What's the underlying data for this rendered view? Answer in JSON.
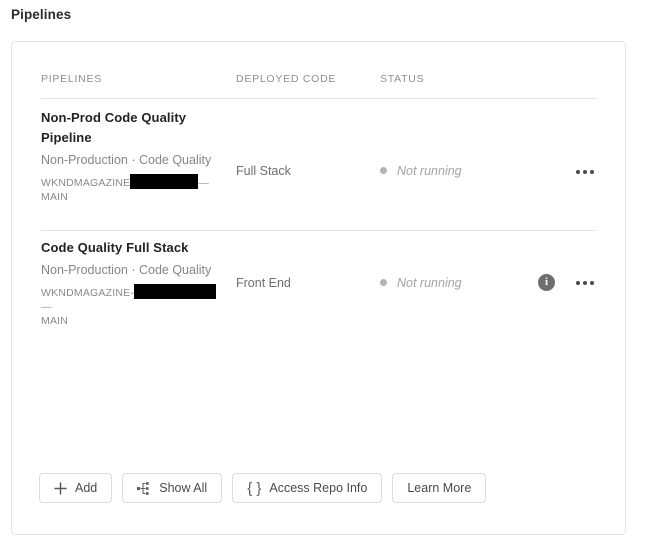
{
  "page": {
    "title": "Pipelines"
  },
  "table": {
    "columns": [
      "PIPELINES",
      "DEPLOYED CODE",
      "STATUS"
    ],
    "rows": [
      {
        "name": "Non-Prod Code Quality Pipeline",
        "subtitle": "Non-Production · Code Quality",
        "repo_prefix": "WKNDMAGAZINE",
        "repo_redacted": "",
        "repo_suffix": "—",
        "repo_branch": "MAIN",
        "deployed_code": "Full Stack",
        "status": "Not running",
        "status_color": "#b5b5b5",
        "has_info_icon": false
      },
      {
        "name": "Code Quality Full Stack",
        "subtitle": "Non-Production · Code Quality",
        "repo_prefix": "WKNDMAGAZINE-",
        "repo_redacted": "",
        "repo_suffix": "—",
        "repo_branch": "MAIN",
        "deployed_code": "Front End",
        "status": "Not running",
        "status_color": "#b5b5b5",
        "has_info_icon": true
      }
    ]
  },
  "footer": {
    "buttons": [
      {
        "label": "Add",
        "icon": "plus-icon"
      },
      {
        "label": "Show All",
        "icon": "hierarchy-icon"
      },
      {
        "label": "Access Repo Info",
        "icon": "braces-icon"
      },
      {
        "label": "Learn More",
        "icon": ""
      }
    ]
  },
  "colors": {
    "card_border": "#e6e6e6",
    "divider": "#e4e4e4",
    "muted_text": "#8e8e8e",
    "title_text": "#232323"
  }
}
